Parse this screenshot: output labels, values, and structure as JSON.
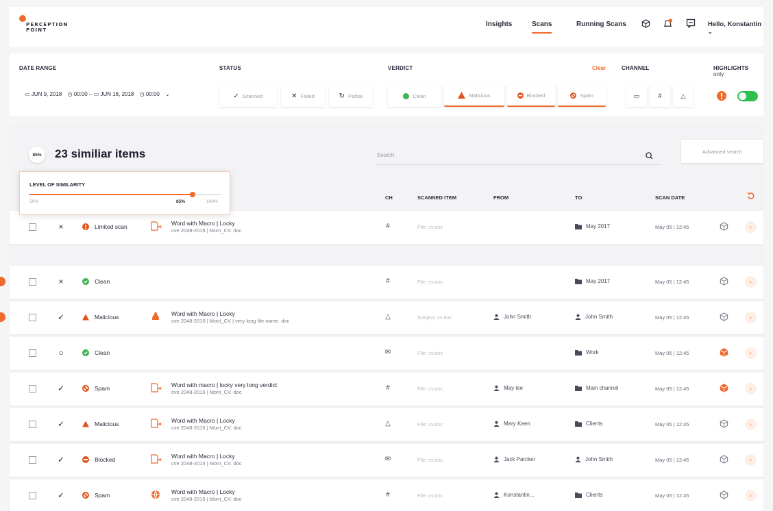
{
  "brand": {
    "line1": "PERCEPTION",
    "line2": "POINT",
    "accent": "#ef6a2d"
  },
  "nav": {
    "insights": "Insights",
    "scans": "Scans",
    "running": "Running Scans",
    "greeting": "Hello, Konstantin",
    "icons": [
      "cube-icon",
      "bell-icon",
      "message-icon",
      "chevron-down-icon"
    ]
  },
  "filters": {
    "date_range_label": "DATE RANGE",
    "date_from": "JUN 9, 2018",
    "time_from": "00:00",
    "date_to": "JUN 16, 2018",
    "time_to": "00:00",
    "status_label": "STATUS",
    "status": [
      "Scanned",
      "Failed",
      "Partial"
    ],
    "verdict_label": "VERDICT",
    "verdict": [
      "Clean",
      "Malicious",
      "Blocked",
      "Spam"
    ],
    "clear": "Clear",
    "channel_label": "CHANNEL",
    "highlights_label": "HIGHLIGHTS",
    "highlights_sub": "only",
    "highlights_on": true
  },
  "results": {
    "similarity_badge": "85%",
    "title": "23 similiar items",
    "search_placeholder": "Search",
    "advanced": "Advanced search",
    "similarity": {
      "label": "LEVEL OF SIMILARITY",
      "min": "50%",
      "value": "85%",
      "max": "100%",
      "fraction": 0.85
    },
    "columns": {
      "ch": "CH",
      "item": "SCANNED ITEM",
      "from": "FROM",
      "to": "TO",
      "date": "SCAN DATE"
    }
  },
  "rows": [
    {
      "action": "×",
      "verdict": "Limited scan",
      "vcolor": "#e0541e",
      "vshape": "info",
      "title": "Word with Macro | Locky",
      "sub": "cve 2048-2016 | Mont_CV. doc",
      "scanned": "File: cv.doc",
      "from": "",
      "to": "May 2017",
      "to_icon": "folder-icon",
      "date": "May 05 | 12:45",
      "flag": false,
      "box_color": "#8a8a96"
    },
    {
      "action": "×",
      "verdict": "Clean",
      "vcolor": "#3fb34f",
      "vshape": "check",
      "title": "",
      "sub": "",
      "scanned": "File: cv.doc",
      "from": "",
      "to": "May 2017",
      "to_icon": "folder-icon",
      "date": "May 05 | 12:45",
      "flag": true,
      "box_color": "#8a8a96"
    },
    {
      "action": "✓",
      "verdict": "Malicious",
      "vcolor": "#e0541e",
      "vshape": "triangle",
      "title": "Word with Macro | Locky",
      "sub": "cve 2048-2016 | Mont_CV | very long file name. doc",
      "scanned": "Subject: cv.doc",
      "from": "John Smith",
      "to": "John Smith",
      "to_icon": "user-icon",
      "date": "May 05 | 12:45",
      "flag": true,
      "box_color": "#8a8a96"
    },
    {
      "action": "○",
      "verdict": "Clean",
      "vcolor": "#3fb34f",
      "vshape": "check",
      "title": "",
      "sub": "",
      "scanned": "File: cv.doc",
      "from": "",
      "to": "Work",
      "to_icon": "folder-icon",
      "date": "May 05 | 12:45",
      "flag": false,
      "box_color": "#ef6a2d"
    },
    {
      "action": "✓",
      "verdict": "Spam",
      "vcolor": "#e0541e",
      "vshape": "ban",
      "title": "Word with macro | locky very long verdict",
      "sub": "cve 2048-2016 | Mont_CV. doc",
      "scanned": "File: cv.doc",
      "from": "May lee",
      "to": "Main channel",
      "to_icon": "folder-icon",
      "date": "May 05 | 12:45",
      "flag": false,
      "box_color": "#ef6a2d"
    },
    {
      "action": "✓",
      "verdict": "Malicious",
      "vcolor": "#e0541e",
      "vshape": "triangle",
      "title": "Word with Macro | Locky",
      "sub": "cve 2048-2016 | Mont_CV. doc",
      "scanned": "File: cv.doc",
      "from": "Mary Keen",
      "to": "Clients",
      "to_icon": "folder-icon",
      "date": "May 05 | 12:45",
      "flag": false,
      "box_color": "#8a8a96"
    },
    {
      "action": "✓",
      "verdict": "Blocked",
      "vcolor": "#e0541e",
      "vshape": "minus",
      "title": "Word with Macro | Locky",
      "sub": "cve 2048-2016 | Mont_CV. doc",
      "scanned": "File: cv.doc",
      "from": "Jack Parcker",
      "to": "John Smith",
      "to_icon": "user-icon",
      "date": "May 05 | 12:45",
      "flag": false,
      "box_color": "#8a8a96"
    },
    {
      "action": "✓",
      "verdict": "Spam",
      "vcolor": "#e0541e",
      "vshape": "ban",
      "title": "Word with Macro | Locky",
      "sub": "cve 2048-2016 | Mont_CV. doc",
      "scanned": "File: cv.doc",
      "from": "Konstantin...",
      "to": "Clients",
      "to_icon": "folder-icon",
      "date": "May 05 | 12:45",
      "flag": false,
      "box_color": "#8a8a96"
    }
  ]
}
